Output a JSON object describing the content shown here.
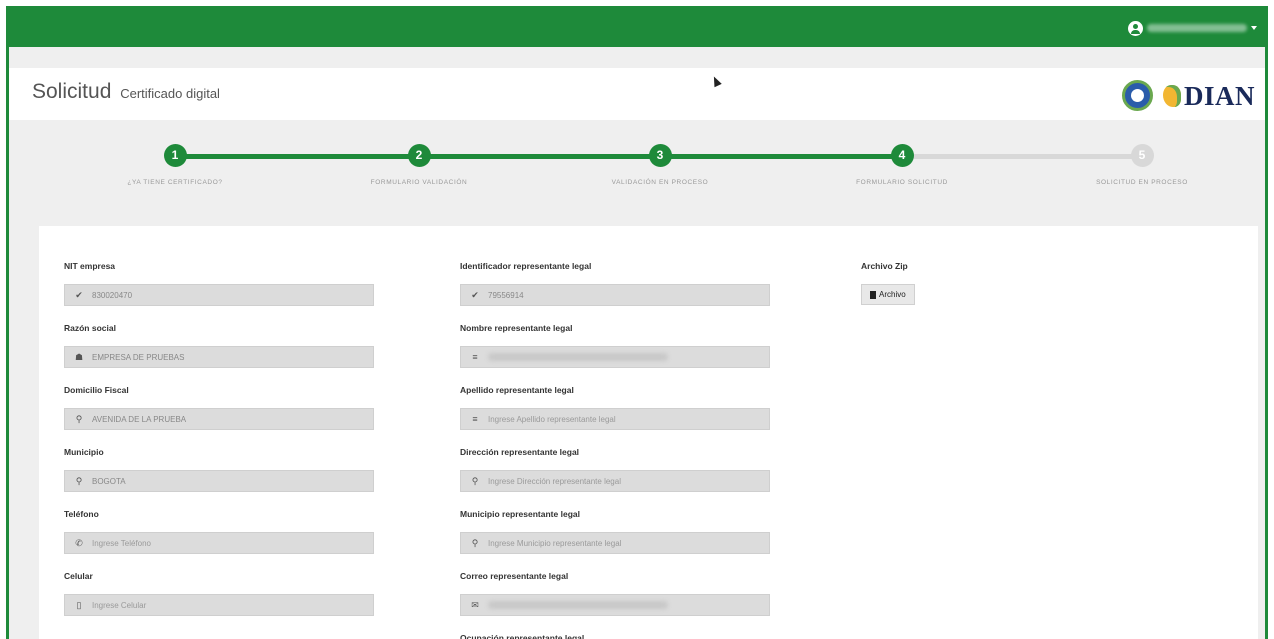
{
  "header": {
    "title": "Solicitud",
    "subtitle": "Certificado digital",
    "logo_text": "DIAN"
  },
  "user_menu": {
    "icon": "user-circle-icon"
  },
  "steps": [
    {
      "number": "1",
      "label": "¿YA TIENE CERTIFICADO?",
      "state": "done"
    },
    {
      "number": "2",
      "label": "FORMULARIO VALIDACIÓN",
      "state": "done"
    },
    {
      "number": "3",
      "label": "VALIDACIÓN EN PROCESO",
      "state": "done"
    },
    {
      "number": "4",
      "label": "FORMULARIO SOLICITUD",
      "state": "current"
    },
    {
      "number": "5",
      "label": "SOLICITUD EN PROCESO",
      "state": "pending"
    }
  ],
  "form": {
    "left": [
      {
        "label": "NIT empresa",
        "icon": "check-icon",
        "glyph": "✔",
        "value": "830020470",
        "placeholder": ""
      },
      {
        "label": "Razón social",
        "icon": "home-icon",
        "glyph": "☗",
        "value": "EMPRESA DE PRUEBAS",
        "placeholder": ""
      },
      {
        "label": "Domicilio Fiscal",
        "icon": "map-marker-icon",
        "glyph": "⚲",
        "value": "AVENIDA DE LA PRUEBA",
        "placeholder": ""
      },
      {
        "label": "Municipio",
        "icon": "map-marker-icon",
        "glyph": "⚲",
        "value": "BOGOTA",
        "placeholder": ""
      },
      {
        "label": "Teléfono",
        "icon": "phone-icon",
        "glyph": "✆",
        "value": "",
        "placeholder": "Ingrese Teléfono"
      },
      {
        "label": "Celular",
        "icon": "mobile-icon",
        "glyph": "▯",
        "value": "",
        "placeholder": "Ingrese Celular"
      }
    ],
    "middle": [
      {
        "label": "Identificador representante legal",
        "icon": "check-icon",
        "glyph": "✔",
        "value": "79556914",
        "placeholder": ""
      },
      {
        "label": "Nombre representante legal",
        "icon": "list-icon",
        "glyph": "≡",
        "value": "",
        "placeholder": ""
      },
      {
        "label": "Apellido representante legal",
        "icon": "list-icon",
        "glyph": "≡",
        "value": "",
        "placeholder": "Ingrese Apellido representante legal"
      },
      {
        "label": "Dirección representante legal",
        "icon": "map-marker-icon",
        "glyph": "⚲",
        "value": "",
        "placeholder": "Ingrese Dirección representante legal"
      },
      {
        "label": "Municipio representante legal",
        "icon": "map-marker-icon",
        "glyph": "⚲",
        "value": "",
        "placeholder": "Ingrese Municipio representante legal"
      },
      {
        "label": "Correo representante legal",
        "icon": "envelope-icon",
        "glyph": "✉",
        "value": "",
        "placeholder": ""
      },
      {
        "label": "Ocupación representante legal",
        "icon": "",
        "glyph": "",
        "value": "",
        "placeholder": ""
      }
    ],
    "zip": {
      "label": "Archivo Zip",
      "button_label": "Archivo"
    }
  }
}
